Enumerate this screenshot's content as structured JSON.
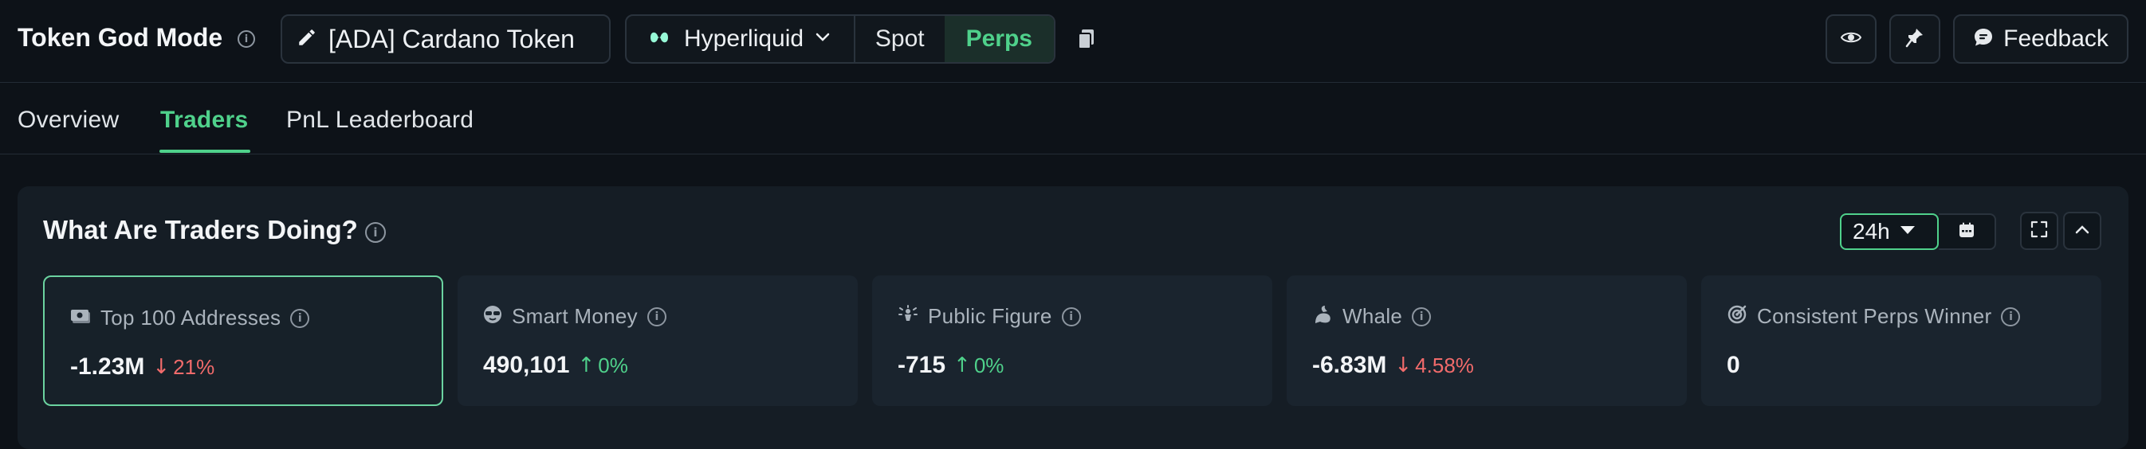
{
  "header": {
    "title": "Token God Mode",
    "token_label": "[ADA] Cardano Token",
    "chain_label": "Hyperliquid",
    "market_spot": "Spot",
    "market_perps": "Perps",
    "feedback_label": "Feedback"
  },
  "tabs": [
    {
      "label": "Overview",
      "active": false
    },
    {
      "label": "Traders",
      "active": true
    },
    {
      "label": "PnL Leaderboard",
      "active": false
    }
  ],
  "panel": {
    "title": "What Are Traders Doing?",
    "range": "24h",
    "cards": [
      {
        "label": "Top 100 Addresses",
        "value": "-1.23M",
        "change": "21%",
        "direction": "down",
        "icon": "money-icon",
        "selected": true
      },
      {
        "label": "Smart Money",
        "value": "490,101",
        "change": "0%",
        "direction": "up",
        "icon": "sunglasses-icon",
        "selected": false
      },
      {
        "label": "Public Figure",
        "value": "-715",
        "change": "0%",
        "direction": "up",
        "icon": "spotlight-icon",
        "selected": false
      },
      {
        "label": "Whale",
        "value": "-6.83M",
        "change": "4.58%",
        "direction": "down",
        "icon": "whale-icon",
        "selected": false
      },
      {
        "label": "Consistent Perps Winner",
        "value": "0",
        "change": "",
        "direction": "none",
        "icon": "target-icon",
        "selected": false
      }
    ]
  },
  "colors": {
    "accent": "#4fd18b",
    "negative": "#f26b6b",
    "background": "#0d1218",
    "panel": "#151d25"
  }
}
